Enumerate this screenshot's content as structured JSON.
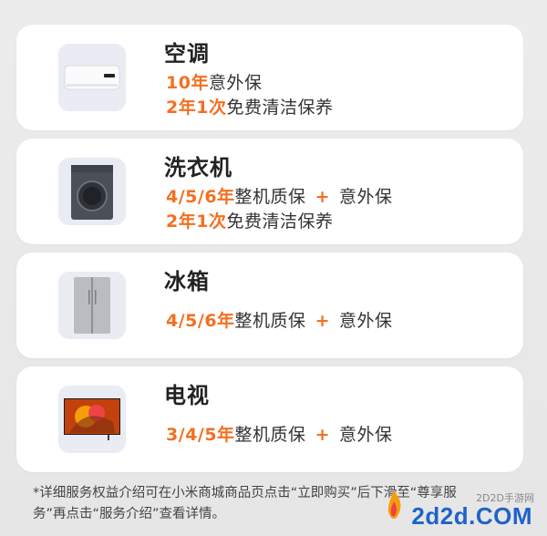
{
  "cards": [
    {
      "title": "空调",
      "lines": [
        {
          "hl": "10年",
          "text": "意外保"
        },
        {
          "hl": "2年1次",
          "text": "免费清洁保养"
        }
      ],
      "icon": "air-conditioner-icon"
    },
    {
      "title": "洗衣机",
      "lines": [
        {
          "hl": "4/5/6年",
          "text": "整机质保",
          "plus": "+",
          "after": "意外保"
        },
        {
          "hl": "2年1次",
          "text": "免费清洁保养"
        }
      ],
      "icon": "washing-machine-icon"
    },
    {
      "title": "冰箱",
      "lines": [
        {
          "hl": "4/5/6年",
          "text": "整机质保",
          "plus": "+",
          "after": "意外保"
        }
      ],
      "icon": "refrigerator-icon"
    },
    {
      "title": "电视",
      "lines": [
        {
          "hl": "3/4/5年",
          "text": "整机质保",
          "plus": "+",
          "after": "意外保"
        }
      ],
      "icon": "tv-icon"
    }
  ],
  "footnote": {
    "line1": "*详细服务权益介绍可在小米商城商品页点击“立即购买”后下滑至“尊享服",
    "line2": "务”再点击“服务介绍”查看详情。"
  },
  "watermark": {
    "logo": "2d2d.COM",
    "sub": "2D2D手游网"
  },
  "colors": {
    "accent": "#f37021",
    "card_bg": "#ffffff",
    "page_bg": "#e8e8e8"
  }
}
